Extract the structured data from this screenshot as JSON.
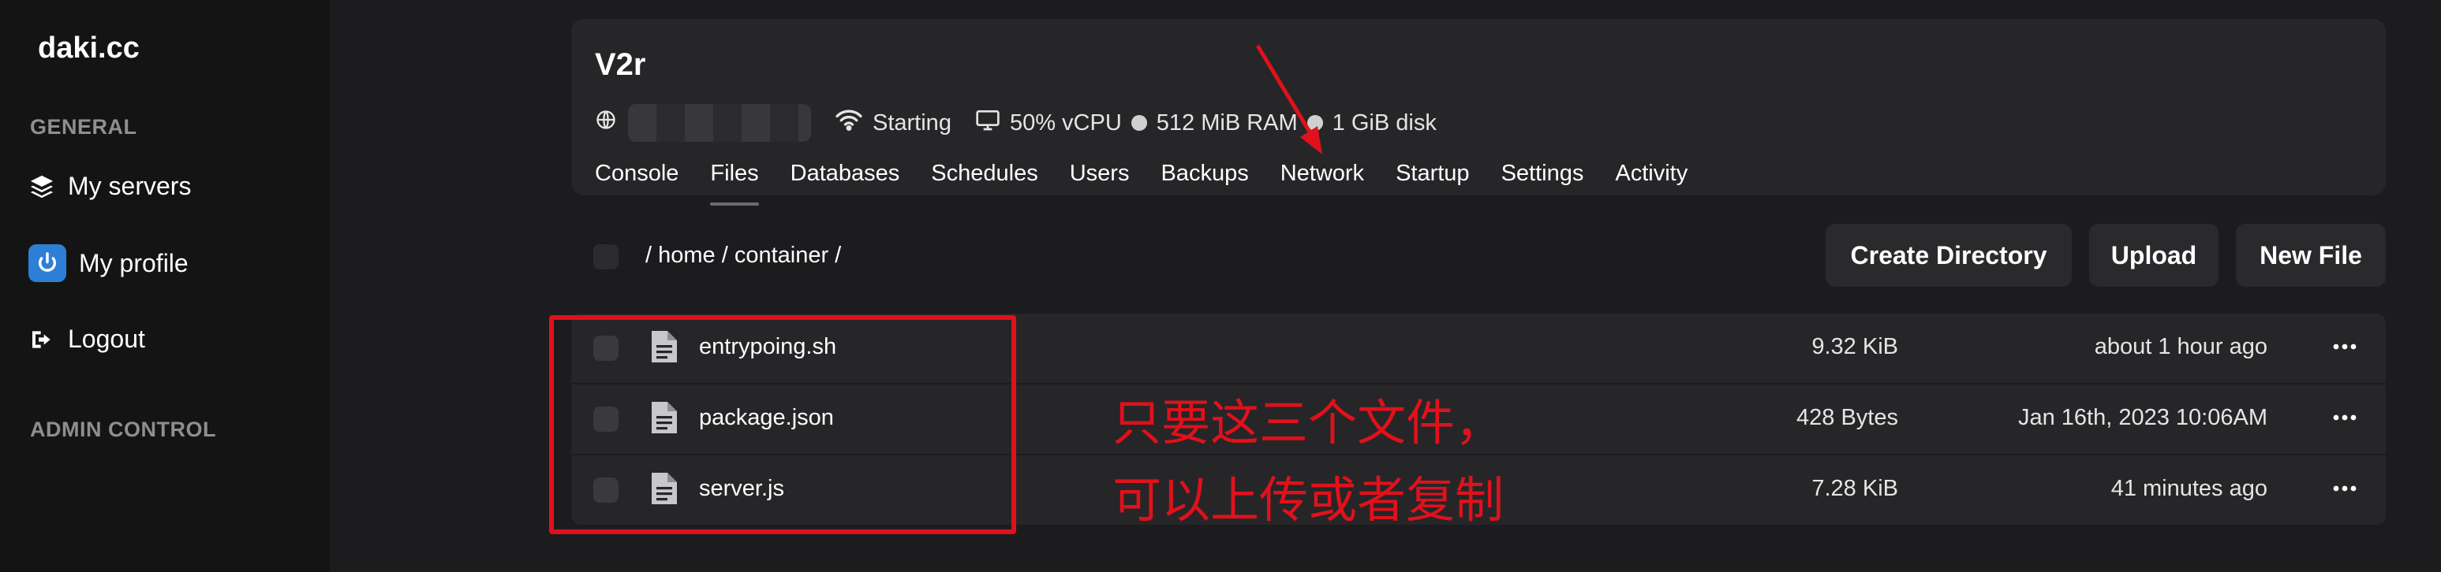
{
  "sidebar": {
    "brand": "daki.cc",
    "general_label": "GENERAL",
    "items": [
      {
        "label": "My servers",
        "icon": "stack-icon"
      },
      {
        "label": "My profile",
        "icon": "power-icon"
      },
      {
        "label": "Logout",
        "icon": "logout-icon"
      }
    ],
    "admin_label": "ADMIN CONTROL"
  },
  "server": {
    "name": "V2r",
    "status": "Starting",
    "cpu": "50% vCPU",
    "ram": "512 MiB RAM",
    "disk": "1 GiB disk"
  },
  "tabs": [
    {
      "label": "Console"
    },
    {
      "label": "Files",
      "active": true
    },
    {
      "label": "Databases"
    },
    {
      "label": "Schedules"
    },
    {
      "label": "Users"
    },
    {
      "label": "Backups"
    },
    {
      "label": "Network"
    },
    {
      "label": "Startup"
    },
    {
      "label": "Settings"
    },
    {
      "label": "Activity"
    }
  ],
  "breadcrumb": "/ home / container /",
  "actions": {
    "create_directory": "Create Directory",
    "upload": "Upload",
    "new_file": "New File"
  },
  "files": [
    {
      "name": "entrypoing.sh",
      "size": "9.32 KiB",
      "modified": "about 1 hour ago"
    },
    {
      "name": "package.json",
      "size": "428 Bytes",
      "modified": "Jan 16th, 2023 10:06AM"
    },
    {
      "name": "server.js",
      "size": "7.28 KiB",
      "modified": "41 minutes ago"
    }
  ],
  "annotation": {
    "line1": "只要这三个文件，",
    "line2": "可以上传或者复制"
  },
  "colors": {
    "annotation_red": "#e0111b",
    "background": "#1c1c1e",
    "sidebar": "#141414",
    "card": "#262628",
    "accent_blue": "#2d7fd6"
  }
}
